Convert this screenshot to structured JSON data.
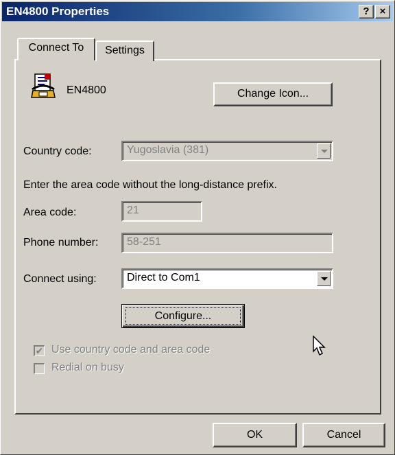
{
  "window": {
    "title": "EN4800 Properties"
  },
  "titlebar": {
    "help_label": "?",
    "close_label": "×"
  },
  "tabs": [
    {
      "label": "Connect To"
    },
    {
      "label": "Settings"
    }
  ],
  "connection": {
    "name": "EN4800",
    "change_icon_label": "Change Icon...",
    "icon": "phone-connection-icon"
  },
  "country_code": {
    "label": "Country code:",
    "value": "Yugoslavia (381)"
  },
  "area_note": "Enter the area code without the long-distance prefix.",
  "area_code": {
    "label": "Area code:",
    "value": "21"
  },
  "phone_number": {
    "label": "Phone number:",
    "value": "58-251"
  },
  "connect_using": {
    "label": "Connect using:",
    "value": "Direct to Com1"
  },
  "configure_label": "Configure...",
  "use_country_code": {
    "label": "Use country code and area code",
    "checked": true
  },
  "redial_on_busy": {
    "label": "Redial on busy",
    "checked": false
  },
  "footer": {
    "ok_label": "OK",
    "cancel_label": "Cancel"
  },
  "colors": {
    "face": "#d4d0c8",
    "title_start": "#0a246a",
    "title_end": "#a6caf0"
  }
}
